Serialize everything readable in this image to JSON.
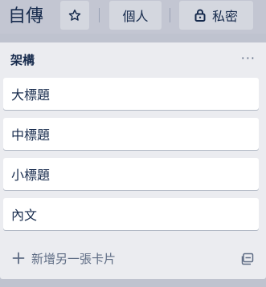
{
  "header": {
    "board_title": "自傳",
    "privacy_label": "個人",
    "visibility_label": "私密",
    "icons": {
      "star": "star-icon",
      "lock": "lock-icon"
    }
  },
  "list": {
    "title": "架構",
    "menu_label": "···",
    "cards": [
      {
        "label": "大標題"
      },
      {
        "label": "中標題"
      },
      {
        "label": "小標題"
      },
      {
        "label": "內文"
      }
    ],
    "add_card_label": "新增另一張卡片",
    "icons": {
      "add": "plus-icon",
      "template": "card-template-icon"
    }
  },
  "colors": {
    "board_background": "#bfc3cf",
    "list_background": "#ebecf0",
    "card_background": "#ffffff",
    "text": "#172b4d",
    "muted_text": "#5e6c84"
  }
}
